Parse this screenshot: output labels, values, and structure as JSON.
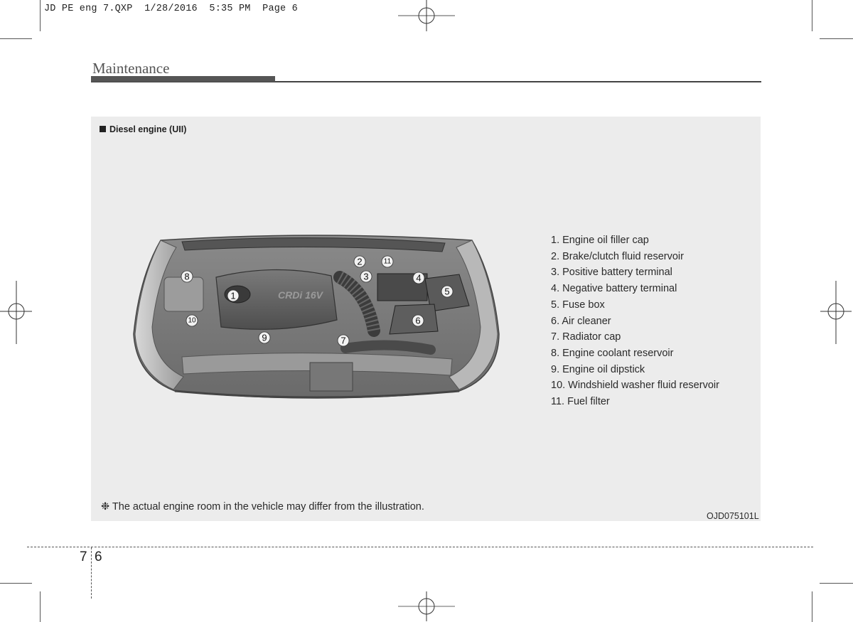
{
  "slug": {
    "text": "JD PE eng 7.QXP  1/28/2016  5:35 PM  Page 6"
  },
  "section": {
    "title": "Maintenance"
  },
  "panel": {
    "heading": "Diesel engine (UII)",
    "heading_icon": "black-square-bullet",
    "callouts": [
      "1",
      "2",
      "3",
      "4",
      "5",
      "6",
      "7",
      "8",
      "9",
      "10",
      "11"
    ],
    "engine_cover_text": "CRDi 16V",
    "legend": [
      "1. Engine oil filler cap",
      "2. Brake/clutch fluid reservoir",
      "3. Positive battery terminal",
      "4. Negative battery terminal",
      "5. Fuse box",
      "6. Air cleaner",
      "7. Radiator cap",
      "8. Engine coolant reservoir",
      "9. Engine oil dipstick",
      "10. Windshield washer fluid reservoir",
      "11. Fuel filter"
    ],
    "note": "❉ The actual engine room in the vehicle may differ from the illustration.",
    "image_code": "OJD075101L"
  },
  "footer": {
    "chapter": "7",
    "page": "6"
  },
  "colors": {
    "panel_bg": "#ececec",
    "title_bar": "#555555",
    "text": "#222222"
  }
}
